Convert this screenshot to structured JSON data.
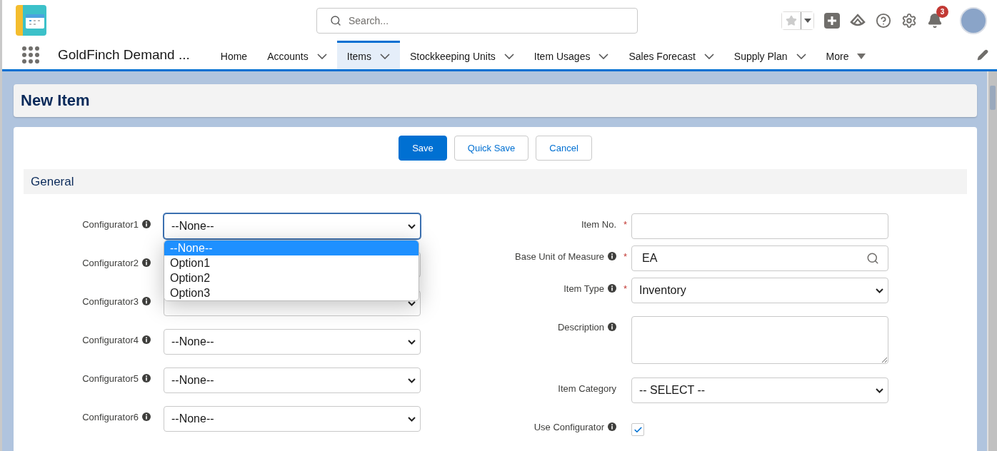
{
  "header": {
    "search_placeholder": "Search...",
    "notification_count": "3"
  },
  "nav": {
    "app_name": "GoldFinch Demand ...",
    "tabs": [
      {
        "label": "Home",
        "kind": "plain",
        "selected": false
      },
      {
        "label": "Accounts",
        "kind": "menu",
        "selected": false
      },
      {
        "label": "Items",
        "kind": "menu",
        "selected": true
      },
      {
        "label": "Stockkeeping Units",
        "kind": "menu",
        "selected": false
      },
      {
        "label": "Item Usages",
        "kind": "menu",
        "selected": false
      },
      {
        "label": "Sales Forecast",
        "kind": "menu",
        "selected": false
      },
      {
        "label": "Supply Plan",
        "kind": "menu",
        "selected": false
      },
      {
        "label": "More",
        "kind": "more",
        "selected": false
      }
    ]
  },
  "page_title": "New Item",
  "buttons": [
    {
      "label": "Save",
      "kind": "primary"
    },
    {
      "label": "Quick Save",
      "kind": "neutral"
    },
    {
      "label": "Cancel",
      "kind": "neutral"
    }
  ],
  "section": {
    "title": "General"
  },
  "left_fields": [
    {
      "label": "Configurator1",
      "value": "--None--",
      "focused": true
    },
    {
      "label": "Configurator2",
      "focused": false
    },
    {
      "label": "Configurator3",
      "focused": false
    },
    {
      "label": "Configurator4",
      "value": "--None--",
      "focused": false
    },
    {
      "label": "Configurator5",
      "value": "--None--",
      "focused": false
    },
    {
      "label": "Configurator6",
      "value": "--None--",
      "focused": false
    }
  ],
  "dropdown": {
    "options": [
      {
        "label": "--None--",
        "selected": true
      },
      {
        "label": "Option1",
        "selected": false
      },
      {
        "label": "Option2",
        "selected": false
      },
      {
        "label": "Option3",
        "selected": false
      }
    ]
  },
  "right_fields": [
    {
      "label": "Item No.",
      "kind": "text",
      "required_mark": "*",
      "info": false
    },
    {
      "label": "Base Unit of Measure",
      "kind": "lookup",
      "value": "EA",
      "required_mark": "*",
      "info": true
    },
    {
      "label": "Item Type",
      "kind": "select",
      "value": "Inventory",
      "required_mark": "*",
      "info": true
    },
    {
      "label": "Description",
      "kind": "textarea",
      "info": true
    },
    {
      "label": "Item Category",
      "kind": "select",
      "value": "-- SELECT --",
      "info": false
    },
    {
      "label": "Use Configurator",
      "kind": "checkbox",
      "checked": true,
      "info": true
    }
  ]
}
